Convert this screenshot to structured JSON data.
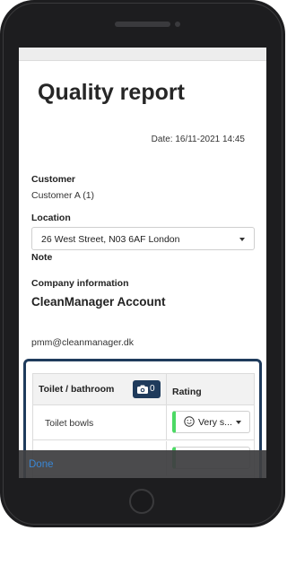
{
  "report": {
    "title": "Quality report",
    "date": "Date: 16/11-2021 14:45"
  },
  "customer": {
    "label": "Customer",
    "value": "Customer A (1)"
  },
  "location": {
    "label": "Location",
    "selected": "26 West Street, N03 6AF London"
  },
  "note": {
    "label": "Note"
  },
  "company": {
    "label": "Company information",
    "name": "CleanManager Account",
    "email": "pmm@cleanmanager.dk"
  },
  "checklist": {
    "area": "Toilet / bathroom",
    "photo_count": "0",
    "rating_header": "Rating",
    "rows": [
      {
        "label": "Toilet bowls",
        "rating": "Very s..."
      },
      {
        "label": "",
        "rating": ""
      }
    ],
    "rating_color": "#4cd964"
  },
  "toolbar": {
    "done_label": "Done"
  },
  "colors": {
    "accent": "#1f3b5c",
    "link": "#3a87d4",
    "device": "#1d1d1f"
  }
}
